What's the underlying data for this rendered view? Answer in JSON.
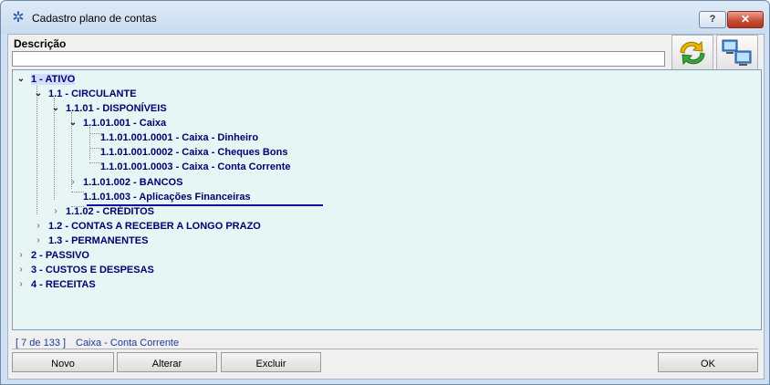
{
  "window": {
    "title": "Cadastro plano de contas",
    "help_label": "?",
    "close_label": "✕"
  },
  "form": {
    "descricao_label": "Descrição",
    "descricao_value": ""
  },
  "tree": {
    "nodes": [
      {
        "label": "1 - ATIVO"
      },
      {
        "label": "1.1 - CIRCULANTE"
      },
      {
        "label": "1.1.01 - DISPONÍVEIS"
      },
      {
        "label": "1.1.01.001 - Caixa"
      },
      {
        "label": "1.1.01.001.0001 - Caixa - Dinheiro"
      },
      {
        "label": "1.1.01.001.0002 - Caixa - Cheques Bons"
      },
      {
        "label": "1.1.01.001.0003 - Caixa - Conta Corrente"
      },
      {
        "label": "1.1.01.002 - BANCOS"
      },
      {
        "label": "1.1.01.003 - Aplicações Financeiras"
      },
      {
        "label": "1.1.02 - CRÉDITOS"
      },
      {
        "label": "1.2 - CONTAS A RECEBER A LONGO PRAZO"
      },
      {
        "label": "1.3 - PERMANENTES"
      },
      {
        "label": "2 - PASSIVO"
      },
      {
        "label": "3 - CUSTOS E DESPESAS"
      },
      {
        "label": "4 - RECEITAS"
      }
    ]
  },
  "status": {
    "count": "[ 7 de 133 ]",
    "text": "Caixa - Conta Corrente"
  },
  "buttons": {
    "novo": "Novo",
    "alterar": "Alterar",
    "excluir": "Excluir",
    "ok": "OK"
  },
  "icons": {
    "refresh": "refresh-icon",
    "network": "network-computers-icon",
    "app": "gear-app-icon"
  }
}
